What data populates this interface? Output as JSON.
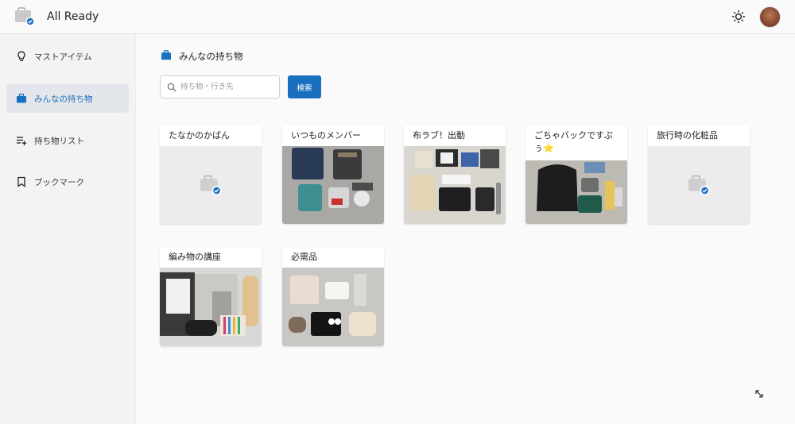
{
  "app": {
    "title": "All Ready"
  },
  "sidebar": {
    "items": [
      {
        "label": "マストアイテム",
        "icon": "lightbulb-icon"
      },
      {
        "label": "みんなの持ち物",
        "icon": "briefcase-icon"
      },
      {
        "label": "持ち物リスト",
        "icon": "playlist-add-icon"
      },
      {
        "label": "ブックマーク",
        "icon": "bookmark-icon"
      }
    ]
  },
  "main": {
    "heading": "みんなの持ち物",
    "search": {
      "placeholder": "持ち物・行き先",
      "value": "",
      "button_label": "検索"
    },
    "cards": [
      {
        "title": "たなかのかばん"
      },
      {
        "title": "いつものメンバー"
      },
      {
        "title": "布ラブ！出動"
      },
      {
        "title": "ごちゃバックですぷぅ⭐"
      },
      {
        "title": "旅行時の化粧品"
      },
      {
        "title": "編み物の講座"
      },
      {
        "title": "必需品"
      }
    ]
  },
  "colors": {
    "accent": "#1b6fbf",
    "sidebar_active": "#e3e6ea"
  }
}
